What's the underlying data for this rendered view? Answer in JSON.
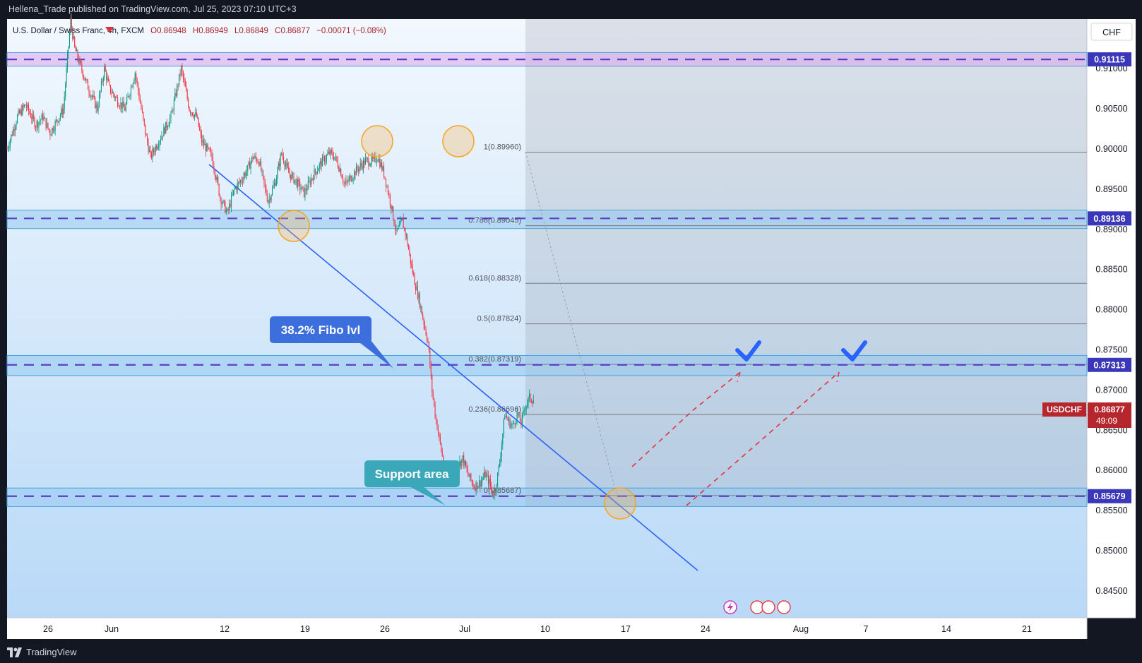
{
  "header": {
    "publisher_line": "Hellena_Trade published on TradingView.com, Jul 25, 2023 07:10 UTC+3"
  },
  "footer": {
    "brand": "TradingView"
  },
  "legend": {
    "symbol": "U.S. Dollar / Swiss Franc, 4h, FXCM",
    "open": "O0.86948",
    "high": "H0.86949",
    "low": "L0.86849",
    "close": "C0.86877",
    "change": "−0.00071 (−0.08%)"
  },
  "currency_badge": "CHF",
  "colors": {
    "up": "#089981",
    "down": "#f23645",
    "level_dash": "#5b3fc4",
    "level_badge": "#3a37b8",
    "band_blue": "#8fc5f0",
    "band_purple": "#d9a6ec",
    "trend_line": "#2962ff",
    "fib_line": "#787b86",
    "callout_blue": "#3d6ede",
    "callout_teal": "#3aa8b8",
    "check": "#2962ff",
    "price_tag": "#b5262d",
    "ring": "#f5a623"
  },
  "annotations": {
    "fibo_callout": "38.2% Fibo lvl",
    "support_callout": "Support area"
  },
  "price_tag": {
    "symbol": "USDCHF",
    "price": "0.86877",
    "countdown": "49:09"
  },
  "chart_data": {
    "type": "candlestick",
    "symbol": "USDCHF",
    "timeframe": "4h",
    "x_ticks": [
      "26",
      "Jun",
      "12",
      "19",
      "26",
      "Jul",
      "10",
      "17",
      "24",
      "Aug",
      "7",
      "14",
      "21"
    ],
    "y_ticks": [
      "0.91000",
      "0.90500",
      "0.90000",
      "0.89500",
      "0.89000",
      "0.88500",
      "0.88000",
      "0.87500",
      "0.87000",
      "0.86500",
      "0.86000",
      "0.85500",
      "0.85000",
      "0.84500"
    ],
    "ylim": [
      0.8425,
      0.9215
    ],
    "key_levels": [
      {
        "price": 0.91115,
        "label": "0.91115",
        "zone": [
          0.9103,
          0.912
        ]
      },
      {
        "price": 0.89136,
        "label": "0.89136",
        "zone": [
          0.8901,
          0.8924
        ]
      },
      {
        "price": 0.87313,
        "label": "0.87313",
        "zone": [
          0.8718,
          0.8743
        ]
      },
      {
        "price": 0.85679,
        "label": "0.85679",
        "zone": [
          0.8555,
          0.8578
        ]
      }
    ],
    "fibonacci": [
      {
        "ratio": 1,
        "price": 0.8996,
        "label": "1(0.89960)"
      },
      {
        "ratio": 0.786,
        "price": 0.89045,
        "label": "0.786(0.89045)"
      },
      {
        "ratio": 0.618,
        "price": 0.88328,
        "label": "0.618(0.88328)"
      },
      {
        "ratio": 0.5,
        "price": 0.87824,
        "label": "0.5(0.87824)"
      },
      {
        "ratio": 0.382,
        "price": 0.87319,
        "label": "0.382(0.87319)"
      },
      {
        "ratio": 0.236,
        "price": 0.86696,
        "label": "0.236(0.86696)"
      },
      {
        "ratio": 0,
        "price": 0.85687,
        "label": "0(0.85687)"
      }
    ],
    "last_price": 0.86877,
    "price_path": [
      [
        0,
        0.9
      ],
      [
        10,
        0.904
      ],
      [
        18,
        0.9055
      ],
      [
        28,
        0.903
      ],
      [
        35,
        0.904
      ],
      [
        42,
        0.902
      ],
      [
        55,
        0.905
      ],
      [
        62,
        0.916
      ],
      [
        66,
        0.9125
      ],
      [
        78,
        0.908
      ],
      [
        88,
        0.905
      ],
      [
        95,
        0.91
      ],
      [
        100,
        0.9075
      ],
      [
        108,
        0.906
      ],
      [
        115,
        0.905
      ],
      [
        125,
        0.9095
      ],
      [
        135,
        0.902
      ],
      [
        140,
        0.899
      ],
      [
        150,
        0.9015
      ],
      [
        160,
        0.904
      ],
      [
        170,
        0.91
      ],
      [
        178,
        0.905
      ],
      [
        185,
        0.904
      ],
      [
        190,
        0.901
      ],
      [
        195,
        0.9
      ],
      [
        200,
        0.899
      ],
      [
        205,
        0.896
      ],
      [
        208,
        0.894
      ],
      [
        215,
        0.892
      ],
      [
        222,
        0.895
      ],
      [
        228,
        0.896
      ],
      [
        235,
        0.8975
      ],
      [
        240,
        0.899
      ],
      [
        246,
        0.8985
      ],
      [
        252,
        0.895
      ],
      [
        255,
        0.8935
      ],
      [
        262,
        0.896
      ],
      [
        268,
        0.8995
      ],
      [
        275,
        0.897
      ],
      [
        282,
        0.896
      ],
      [
        290,
        0.8945
      ],
      [
        300,
        0.897
      ],
      [
        308,
        0.8985
      ],
      [
        315,
        0.8995
      ],
      [
        320,
        0.899
      ],
      [
        325,
        0.8975
      ],
      [
        330,
        0.8955
      ],
      [
        336,
        0.8965
      ],
      [
        342,
        0.8975
      ],
      [
        350,
        0.8985
      ],
      [
        358,
        0.8985
      ],
      [
        362,
        0.899
      ],
      [
        368,
        0.897
      ],
      [
        375,
        0.893
      ],
      [
        380,
        0.8895
      ],
      [
        386,
        0.891
      ],
      [
        390,
        0.889
      ],
      [
        394,
        0.886
      ],
      [
        398,
        0.8835
      ],
      [
        402,
        0.8815
      ],
      [
        406,
        0.879
      ],
      [
        411,
        0.876
      ],
      [
        415,
        0.87
      ],
      [
        418,
        0.867
      ],
      [
        422,
        0.864
      ],
      [
        426,
        0.861
      ],
      [
        431,
        0.8585
      ],
      [
        436,
        0.8595
      ],
      [
        440,
        0.8605
      ],
      [
        445,
        0.8615
      ],
      [
        450,
        0.8595
      ],
      [
        456,
        0.858
      ],
      [
        462,
        0.8585
      ],
      [
        467,
        0.8595
      ],
      [
        471,
        0.8585
      ],
      [
        474,
        0.857
      ],
      [
        477,
        0.8578
      ],
      [
        481,
        0.861
      ],
      [
        486,
        0.867
      ],
      [
        490,
        0.866
      ],
      [
        494,
        0.8655
      ],
      [
        498,
        0.867
      ],
      [
        502,
        0.866
      ],
      [
        506,
        0.868
      ],
      [
        510,
        0.869
      ],
      [
        514,
        0.8688
      ]
    ],
    "bar_count": 515
  }
}
